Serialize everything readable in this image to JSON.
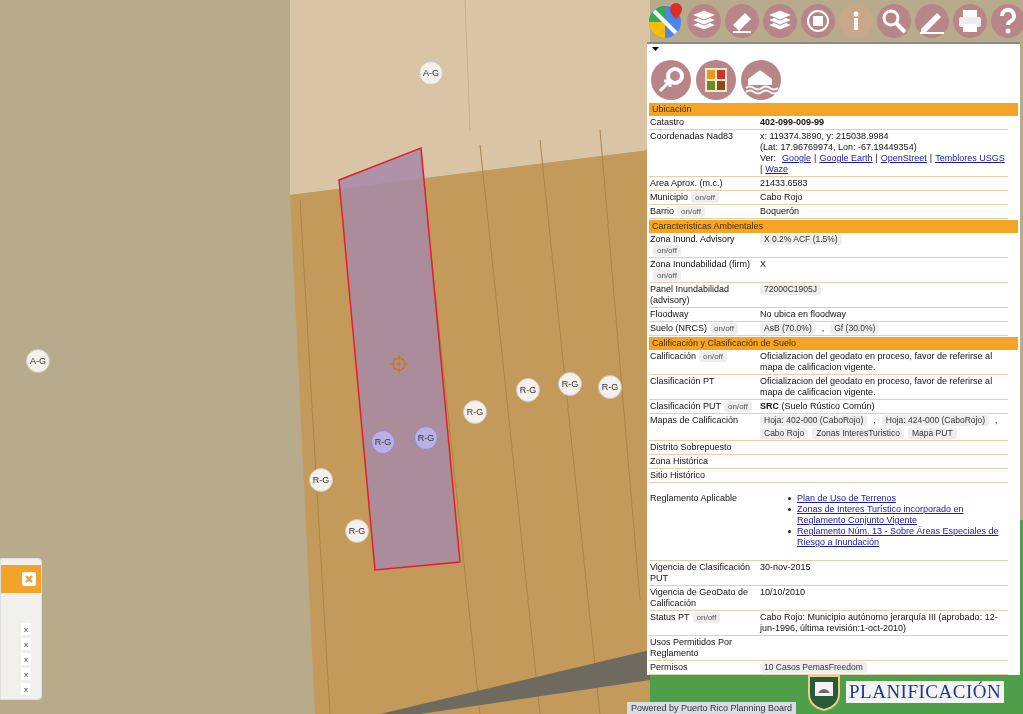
{
  "map_labels": [
    {
      "text": "A-G",
      "selected": false
    },
    {
      "text": "A-G",
      "selected": false
    },
    {
      "text": "R-G",
      "selected": false
    },
    {
      "text": "R-G",
      "selected": false
    },
    {
      "text": "R-G",
      "selected": false
    },
    {
      "text": "R-G",
      "selected": false
    },
    {
      "text": "R-G",
      "selected": true
    },
    {
      "text": "R-G",
      "selected": true
    },
    {
      "text": "R-G",
      "selected": false
    },
    {
      "text": "R-G",
      "selected": false
    }
  ],
  "left_widget": {
    "remove_buttons": [
      "x",
      "x",
      "x",
      "x",
      "x"
    ]
  },
  "info_panel": {
    "sections": [
      {
        "title": "Ubicación",
        "rows": [
          {
            "label": "Catastro",
            "kind": "text",
            "value": "**402-099-009-99**"
          },
          {
            "label": "Coordenadas Nad83",
            "kind": "coords",
            "lines": [
              "x: 119374.3890, y: 215038.9984",
              "(Lat: 17.96769974, Lon: -67.19449354)"
            ],
            "links_label": "Ver:",
            "links": [
              {
                "text": "Google",
                "sep": "|"
              },
              {
                "text": "Google Earth",
                "sep": "|"
              },
              {
                "text": "OpenStreet",
                "sep": "|"
              },
              {
                "text": "Temblores USGS",
                "sep": "|"
              },
              {
                "text": "Waze"
              }
            ]
          },
          {
            "label": "Area Aprox. (m.c.)",
            "kind": "text",
            "value": "21433.6583"
          },
          {
            "label": "Municipio",
            "toggle": "on/off",
            "kind": "text",
            "value": "Cabo Rojo"
          },
          {
            "label": "Barrio",
            "toggle": "on/off",
            "kind": "text",
            "value": "Boquerón"
          }
        ]
      },
      {
        "title": "Caracteristicas Ambientales",
        "rows": [
          {
            "label": "Zona Inund. Advisory",
            "toggle": "on/off",
            "kind": "chips",
            "chips": [
              {
                "text": "X 0.2% ACF (1.5%)"
              }
            ]
          },
          {
            "label": "Zona Inundabilidad (firm)",
            "toggle": "on/off",
            "kind": "text",
            "value": "X"
          },
          {
            "label": "Panel Inundabilidad (advisory)",
            "kind": "chips",
            "chips": [
              {
                "text": "72000C1905J"
              }
            ]
          },
          {
            "label": "Floodway",
            "kind": "text",
            "value": "No ubica en floodway"
          },
          {
            "label": "Suelo (NRCS)",
            "toggle": "on/off",
            "kind": "chips",
            "chips": [
              {
                "text": "AsB (70.0%)",
                "sep": ","
              },
              {
                "text": "Gf (30.0%)"
              }
            ]
          }
        ]
      },
      {
        "title": "Calificación y Clasificación de Suelo",
        "rows": [
          {
            "label": "Calificación",
            "toggle": "on/off",
            "kind": "text",
            "value": "Oficializacion del geodato en proceso, favor de referirse al mapa de calificacion vigente."
          },
          {
            "label": "Clasificación PT",
            "kind": "text",
            "value": "Oficializacion del geodato en proceso, favor de referirse al mapa de calificacion vigente."
          },
          {
            "label": "Clasificación PUT",
            "toggle": "on/off",
            "kind": "text",
            "value": "**SRC** (Suelo Rústico Común)"
          },
          {
            "label": "Mapas de Calificación",
            "kind": "chips",
            "chips": [
              {
                "text": "Hoja: 402-000 (CaboRojo)",
                "sep": ","
              },
              {
                "text": "Hoja: 424-000 (CaboRojo)",
                "sep": ","
              },
              {
                "text": "Cabo Rojo"
              },
              {
                "text": "Zonas InteresTuristico"
              },
              {
                "text": "Mapa PUT"
              }
            ]
          },
          {
            "label": "Distrito Sobrepuesto",
            "kind": "empty"
          },
          {
            "label": "Zona Histórica",
            "kind": "empty"
          },
          {
            "label": "Sitio Histórico",
            "kind": "empty"
          },
          {
            "label": "Reglamento Aplicable",
            "kind": "links",
            "links": [
              "Plan de Uso de Terrenos",
              "Zonas de Interes Turístico incorporado en Reglamento Conjunto Vigente",
              "Reglamento Núm. 13 - Sobre Áreas Especiales de Riesgo a Inundación"
            ]
          },
          {
            "label": "Vigencia de Clasificación PUT",
            "kind": "text",
            "value": "30-nov-2015"
          },
          {
            "label": "Vigencia de GeoDato de Calificación",
            "kind": "text",
            "value": "10/10/2010"
          },
          {
            "label": "Status PT",
            "toggle": "on/off",
            "kind": "text",
            "value": "Cabo Rojo: Municipio autónomo jerarquía III (aprobado: 12-jun-1996, última revisión:1-oct-2010)"
          },
          {
            "label": "Usos Permitidos Por Reglamento",
            "kind": "empty"
          },
          {
            "label": "Permisos",
            "kind": "chips",
            "chips": [
              {
                "text": "10 Casos PemasFreedom"
              }
            ]
          }
        ]
      }
    ]
  },
  "footer": {
    "credit": "Powered by Puerto Rico Planning Board",
    "logo_text": "PLANIFICACIÓN"
  }
}
